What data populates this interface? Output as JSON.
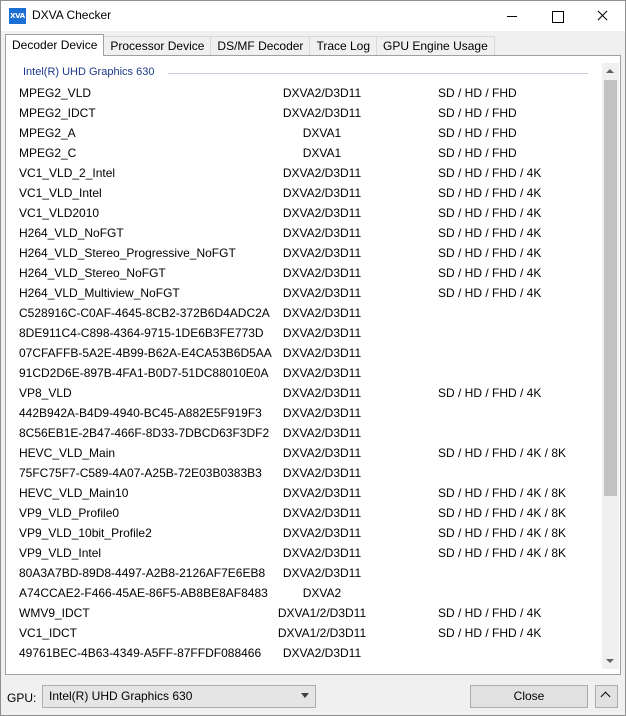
{
  "window": {
    "title": "DXVA Checker",
    "icon_text": "XVA",
    "controls": [
      "minimize",
      "maximize",
      "close"
    ]
  },
  "tabs": [
    {
      "label": "Decoder Device",
      "active": true
    },
    {
      "label": "Processor Device",
      "active": false
    },
    {
      "label": "DS/MF Decoder",
      "active": false
    },
    {
      "label": "Trace Log",
      "active": false
    },
    {
      "label": "GPU Engine Usage",
      "active": false
    }
  ],
  "group": {
    "title": "Intel(R) UHD Graphics 630"
  },
  "decoders": [
    {
      "name": "MPEG2_VLD",
      "api": "DXVA2/D3D11",
      "res": "SD / HD / FHD"
    },
    {
      "name": "MPEG2_IDCT",
      "api": "DXVA2/D3D11",
      "res": "SD / HD / FHD"
    },
    {
      "name": "MPEG2_A",
      "api": "DXVA1",
      "res": "SD / HD / FHD"
    },
    {
      "name": "MPEG2_C",
      "api": "DXVA1",
      "res": "SD / HD / FHD"
    },
    {
      "name": "VC1_VLD_2_Intel",
      "api": "DXVA2/D3D11",
      "res": "SD / HD / FHD / 4K"
    },
    {
      "name": "VC1_VLD_Intel",
      "api": "DXVA2/D3D11",
      "res": "SD / HD / FHD / 4K"
    },
    {
      "name": "VC1_VLD2010",
      "api": "DXVA2/D3D11",
      "res": "SD / HD / FHD / 4K"
    },
    {
      "name": "H264_VLD_NoFGT",
      "api": "DXVA2/D3D11",
      "res": "SD / HD / FHD / 4K"
    },
    {
      "name": "H264_VLD_Stereo_Progressive_NoFGT",
      "api": "DXVA2/D3D11",
      "res": "SD / HD / FHD / 4K"
    },
    {
      "name": "H264_VLD_Stereo_NoFGT",
      "api": "DXVA2/D3D11",
      "res": "SD / HD / FHD / 4K"
    },
    {
      "name": "H264_VLD_Multiview_NoFGT",
      "api": "DXVA2/D3D11",
      "res": "SD / HD / FHD / 4K"
    },
    {
      "name": "C528916C-C0AF-4645-8CB2-372B6D4ADC2A",
      "api": "DXVA2/D3D11",
      "res": ""
    },
    {
      "name": "8DE911C4-C898-4364-9715-1DE6B3FE773D",
      "api": "DXVA2/D3D11",
      "res": ""
    },
    {
      "name": "07CFAFFB-5A2E-4B99-B62A-E4CA53B6D5AA",
      "api": "DXVA2/D3D11",
      "res": ""
    },
    {
      "name": "91CD2D6E-897B-4FA1-B0D7-51DC88010E0A",
      "api": "DXVA2/D3D11",
      "res": ""
    },
    {
      "name": "VP8_VLD",
      "api": "DXVA2/D3D11",
      "res": "SD / HD / FHD / 4K"
    },
    {
      "name": "442B942A-B4D9-4940-BC45-A882E5F919F3",
      "api": "DXVA2/D3D11",
      "res": ""
    },
    {
      "name": "8C56EB1E-2B47-466F-8D33-7DBCD63F3DF2",
      "api": "DXVA2/D3D11",
      "res": ""
    },
    {
      "name": "HEVC_VLD_Main",
      "api": "DXVA2/D3D11",
      "res": "SD / HD / FHD / 4K / 8K"
    },
    {
      "name": "75FC75F7-C589-4A07-A25B-72E03B0383B3",
      "api": "DXVA2/D3D11",
      "res": ""
    },
    {
      "name": "HEVC_VLD_Main10",
      "api": "DXVA2/D3D11",
      "res": "SD / HD / FHD / 4K / 8K"
    },
    {
      "name": "VP9_VLD_Profile0",
      "api": "DXVA2/D3D11",
      "res": "SD / HD / FHD / 4K / 8K"
    },
    {
      "name": "VP9_VLD_10bit_Profile2",
      "api": "DXVA2/D3D11",
      "res": "SD / HD / FHD / 4K / 8K"
    },
    {
      "name": "VP9_VLD_Intel",
      "api": "DXVA2/D3D11",
      "res": "SD / HD / FHD / 4K / 8K"
    },
    {
      "name": "80A3A7BD-89D8-4497-A2B8-2126AF7E6EB8",
      "api": "DXVA2/D3D11",
      "res": ""
    },
    {
      "name": "A74CCAE2-F466-45AE-86F5-AB8BE8AF8483",
      "api": "DXVA2",
      "res": ""
    },
    {
      "name": "WMV9_IDCT",
      "api": "DXVA1/2/D3D11",
      "res": "SD / HD / FHD / 4K"
    },
    {
      "name": "VC1_IDCT",
      "api": "DXVA1/2/D3D11",
      "res": "SD / HD / FHD / 4K"
    },
    {
      "name": "49761BEC-4B63-4349-A5FF-87FFDF088466",
      "api": "DXVA2/D3D11",
      "res": ""
    }
  ],
  "footer": {
    "gpu_label": "GPU:",
    "gpu_selected": "Intel(R) UHD Graphics 630",
    "close_label": "Close"
  }
}
